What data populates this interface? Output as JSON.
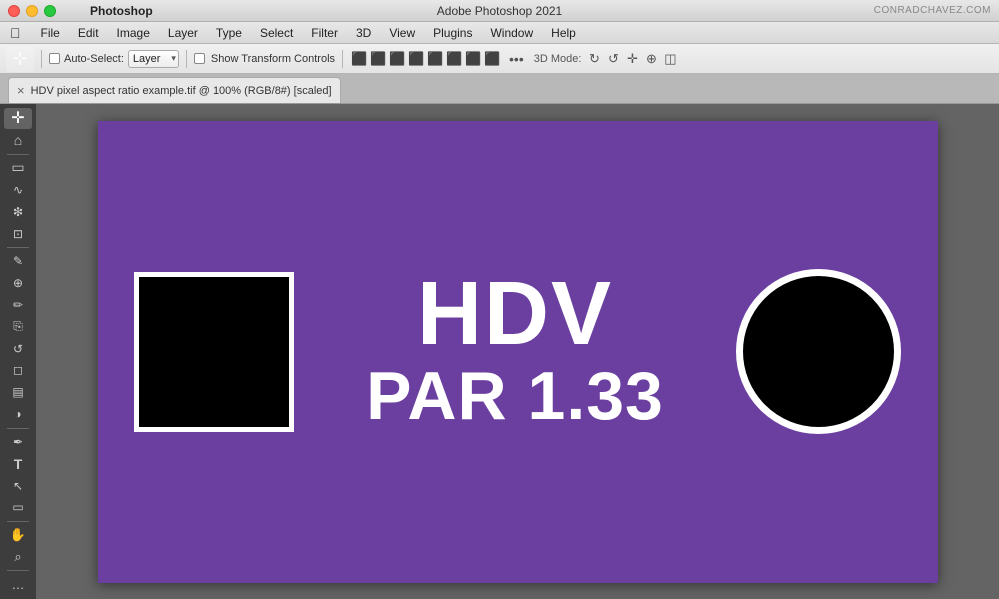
{
  "titleBar": {
    "title": "Adobe Photoshop 2021",
    "website": "CONRADCHAVEZ.COM",
    "trafficLights": [
      "close",
      "minimize",
      "maximize"
    ]
  },
  "menuBar": {
    "appName": "Photoshop",
    "appleLogo": "",
    "items": [
      {
        "label": "File"
      },
      {
        "label": "Edit"
      },
      {
        "label": "Image"
      },
      {
        "label": "Layer"
      },
      {
        "label": "Type"
      },
      {
        "label": "Select"
      },
      {
        "label": "Filter"
      },
      {
        "label": "3D"
      },
      {
        "label": "View"
      },
      {
        "label": "Plugins"
      },
      {
        "label": "Window"
      },
      {
        "label": "Help"
      }
    ]
  },
  "optionsBar": {
    "autoSelectLabel": "Auto-Select:",
    "layerValue": "Layer",
    "showTransformLabel": "Show Transform Controls",
    "moreDots": "•••",
    "modeLabel": "3D Mode:"
  },
  "tabBar": {
    "tab": {
      "closeSymbol": "×",
      "title": "HDV pixel aspect ratio example.tif @ 100% (RGB/8#) [scaled]"
    }
  },
  "sidebar": {
    "tools": [
      {
        "name": "move-tool",
        "icon": "⊹",
        "active": true
      },
      {
        "name": "home-icon",
        "icon": "⌂",
        "active": false
      },
      {
        "name": "marquee-tool",
        "icon": "⬚",
        "active": false
      },
      {
        "name": "lasso-tool",
        "icon": "○",
        "active": false
      },
      {
        "name": "magic-wand-tool",
        "icon": "✦",
        "active": false
      },
      {
        "name": "crop-tool",
        "icon": "⊡",
        "active": false
      },
      {
        "name": "eyedropper-tool",
        "icon": "✎",
        "active": false
      },
      {
        "name": "spot-healing-tool",
        "icon": "✙",
        "active": false
      },
      {
        "name": "brush-tool",
        "icon": "✏",
        "active": false
      },
      {
        "name": "clone-stamp-tool",
        "icon": "⎘",
        "active": false
      },
      {
        "name": "history-brush-tool",
        "icon": "↺",
        "active": false
      },
      {
        "name": "eraser-tool",
        "icon": "◻",
        "active": false
      },
      {
        "name": "gradient-tool",
        "icon": "▤",
        "active": false
      },
      {
        "name": "dodge-tool",
        "icon": "◑",
        "active": false
      },
      {
        "name": "pen-tool",
        "icon": "✒",
        "active": false
      },
      {
        "name": "type-tool",
        "icon": "T",
        "active": false
      },
      {
        "name": "path-selection-tool",
        "icon": "↖",
        "active": false
      },
      {
        "name": "shape-tool",
        "icon": "▭",
        "active": false
      },
      {
        "name": "hand-tool",
        "icon": "✋",
        "active": false
      },
      {
        "name": "zoom-tool",
        "icon": "⌕",
        "active": false
      },
      {
        "name": "extra-tool",
        "icon": "…",
        "active": false
      }
    ]
  },
  "canvas": {
    "backgroundColor": "#6b3fa0",
    "hdvText": "HDV",
    "parText": "PAR 1.33",
    "squareBorder": "#ffffff",
    "circleBorder": "#ffffff"
  }
}
